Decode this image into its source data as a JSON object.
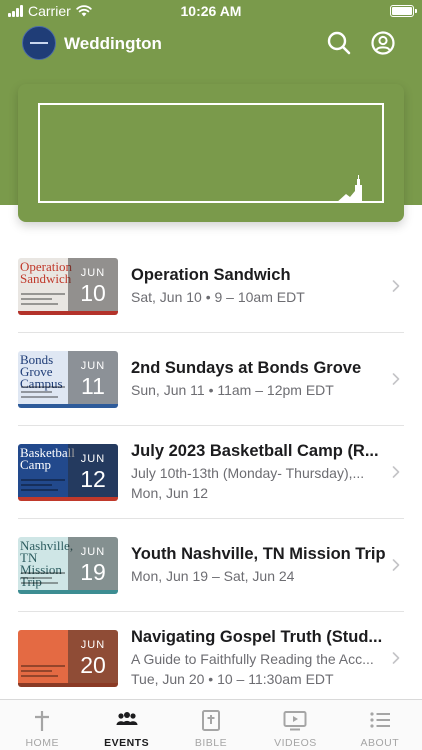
{
  "status_bar": {
    "carrier": "Carrier",
    "time": "10:26 AM",
    "battery_level": 1.0
  },
  "header": {
    "title": "Weddington"
  },
  "colors": {
    "brand_green": "#7a9a4b",
    "logo_navy": "#1f3d77"
  },
  "events": [
    {
      "title": "Operation Sandwich",
      "lines": [
        "Sat, Jun 10 • 9 – 10am EDT"
      ],
      "thumb": {
        "text": "Operation Sandwich",
        "month": "JUN",
        "day": "10",
        "bg": "#e9e6e2",
        "accent": "#b3322a",
        "text_color": "#c0392b"
      }
    },
    {
      "title": "2nd Sundays at Bonds Grove",
      "lines": [
        "Sun, Jun 11 • 11am – 12pm EDT"
      ],
      "thumb": {
        "text": "Bonds Grove Campus",
        "month": "JUN",
        "day": "11",
        "bg": "#dfe7f3",
        "accent": "#2e5b9a",
        "text_color": "#1f3d77"
      }
    },
    {
      "title": "July 2023 Basketball Camp (R...",
      "lines": [
        "July 10th-13th (Monday- Thursday),...",
        "Mon, Jun 12"
      ],
      "thumb": {
        "text": "Basketball Camp",
        "month": "JUN",
        "day": "12",
        "bg": "#22498c",
        "accent": "#c0392b",
        "text_color": "#ffffff"
      }
    },
    {
      "title": "Youth Nashville, TN Mission Trip",
      "lines": [
        "Mon, Jun 19 – Sat, Jun 24"
      ],
      "thumb": {
        "text": "Nashville, TN Mission Trip",
        "month": "JUN",
        "day": "19",
        "bg": "#cfe6e6",
        "accent": "#3d8d92",
        "text_color": "#2d5d60"
      }
    },
    {
      "title": "Navigating Gospel Truth (Stud...",
      "lines": [
        "A Guide to Faithfully Reading the Acc...",
        "Tue, Jun 20 • 10 – 11:30am EDT"
      ],
      "thumb": {
        "text": "",
        "month": "JUN",
        "day": "20",
        "bg": "#e46a43",
        "accent": "#8a3a25",
        "text_color": "#ffffff"
      }
    }
  ],
  "tabs": [
    {
      "label": "HOME",
      "icon": "cross-icon",
      "active": false
    },
    {
      "label": "EVENTS",
      "icon": "people-icon",
      "active": true
    },
    {
      "label": "BIBLE",
      "icon": "bible-icon",
      "active": false
    },
    {
      "label": "VIDEOS",
      "icon": "video-icon",
      "active": false
    },
    {
      "label": "ABOUT",
      "icon": "list-icon",
      "active": false
    }
  ]
}
